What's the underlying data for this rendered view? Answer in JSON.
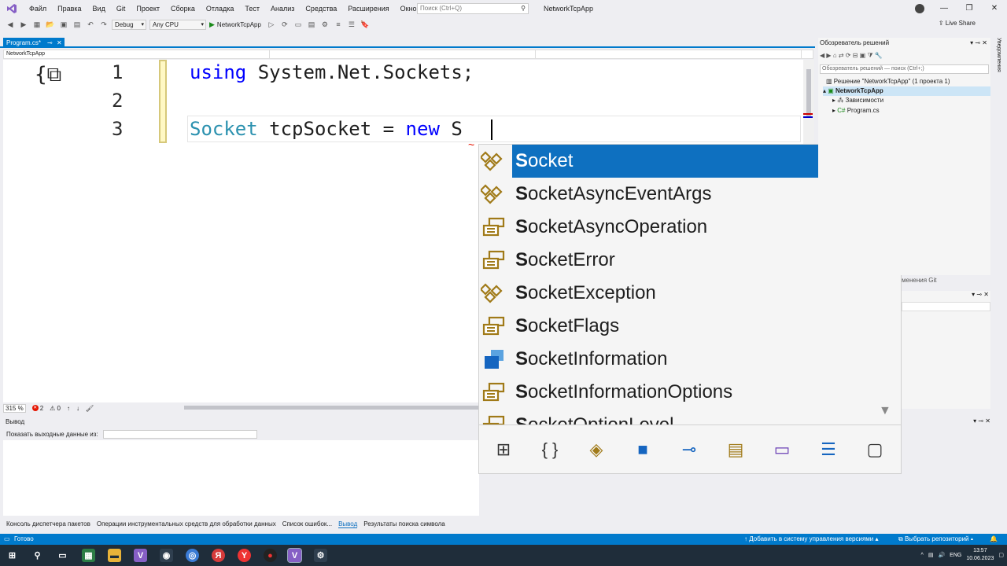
{
  "menubar": {
    "items": [
      "Файл",
      "Правка",
      "Вид",
      "Git",
      "Проект",
      "Сборка",
      "Отладка",
      "Тест",
      "Анализ",
      "Средства",
      "Расширения",
      "Окно",
      "Справка"
    ],
    "search_placeholder": "Поиск (Ctrl+Q)",
    "window_title": "NetworkTcpApp"
  },
  "toolbar": {
    "config": "Debug",
    "platform": "Any CPU",
    "run_target": "NetworkTcpApp",
    "live_share": "Live Share"
  },
  "document": {
    "tab_label": "Program.cs*",
    "nav_project": "NetworkTcpApp"
  },
  "editor": {
    "line_numbers": [
      "1",
      "2",
      "3"
    ],
    "line1": {
      "kw": "using",
      "rest": " System.Net.Sockets;"
    },
    "line3": {
      "type": "Socket",
      "rest1": " tcpSocket = ",
      "kw": "new",
      "rest2": " S"
    },
    "zoom": "315 %",
    "errors": "2",
    "warnings": "0"
  },
  "completion": {
    "items": [
      {
        "prefix": "S",
        "rest": "ocket",
        "icon": "class-icon",
        "selected": true
      },
      {
        "prefix": "S",
        "rest": "ocketAsyncEventArgs",
        "icon": "class-icon"
      },
      {
        "prefix": "S",
        "rest": "ocketAsyncOperation",
        "icon": "enum-icon"
      },
      {
        "prefix": "S",
        "rest": "ocketError",
        "icon": "enum-icon"
      },
      {
        "prefix": "S",
        "rest": "ocketException",
        "icon": "class-icon"
      },
      {
        "prefix": "S",
        "rest": "ocketFlags",
        "icon": "enum-icon"
      },
      {
        "prefix": "S",
        "rest": "ocketInformation",
        "icon": "struct-icon"
      },
      {
        "prefix": "S",
        "rest": "ocketInformationOptions",
        "icon": "enum-icon"
      },
      {
        "prefix": "S",
        "rest": "ocketOptionLevel",
        "icon": "enum-icon"
      }
    ],
    "filters": [
      "add-using-filter-icon",
      "namespace-filter-icon",
      "class-filter-icon",
      "struct-filter-icon",
      "interface-filter-icon",
      "enum-filter-icon",
      "delegate-filter-icon",
      "snippet-filter-icon",
      "target-typed-filter-icon"
    ]
  },
  "output": {
    "title": "Вывод",
    "show_from_label": "Показать выходные данные из:"
  },
  "bottom_tabs": [
    "Консоль диспетчера пакетов",
    "Операции инструментальных средств для обработки данных",
    "Список ошибок...",
    "Вывод",
    "Результаты поиска символа"
  ],
  "solution_explorer": {
    "title": "Обозреватель решений",
    "search_placeholder": "Обозреватель решений — поиск (Ctrl+;)",
    "solution_label": "Решение \"NetworkTcpApp\" (1 проекта 1)",
    "project_label": "NetworkTcpApp",
    "deps_label": "Зависимости",
    "file_label": "Program.cs",
    "git_changes": "менения Git"
  },
  "right_rail": {
    "label": "Уведомления"
  },
  "statusbar": {
    "ready": "Готово",
    "add_vcs": "Добавить в систему управления версиями",
    "repo": "Выбрать репозиторий"
  },
  "taskbar": {
    "lang": "ENG",
    "time": "13:57",
    "date": "10.06.2023"
  },
  "colors": {
    "accent": "#007acc",
    "selection": "#0e70c0",
    "keyword": "#0000ff",
    "type": "#2b91af"
  }
}
